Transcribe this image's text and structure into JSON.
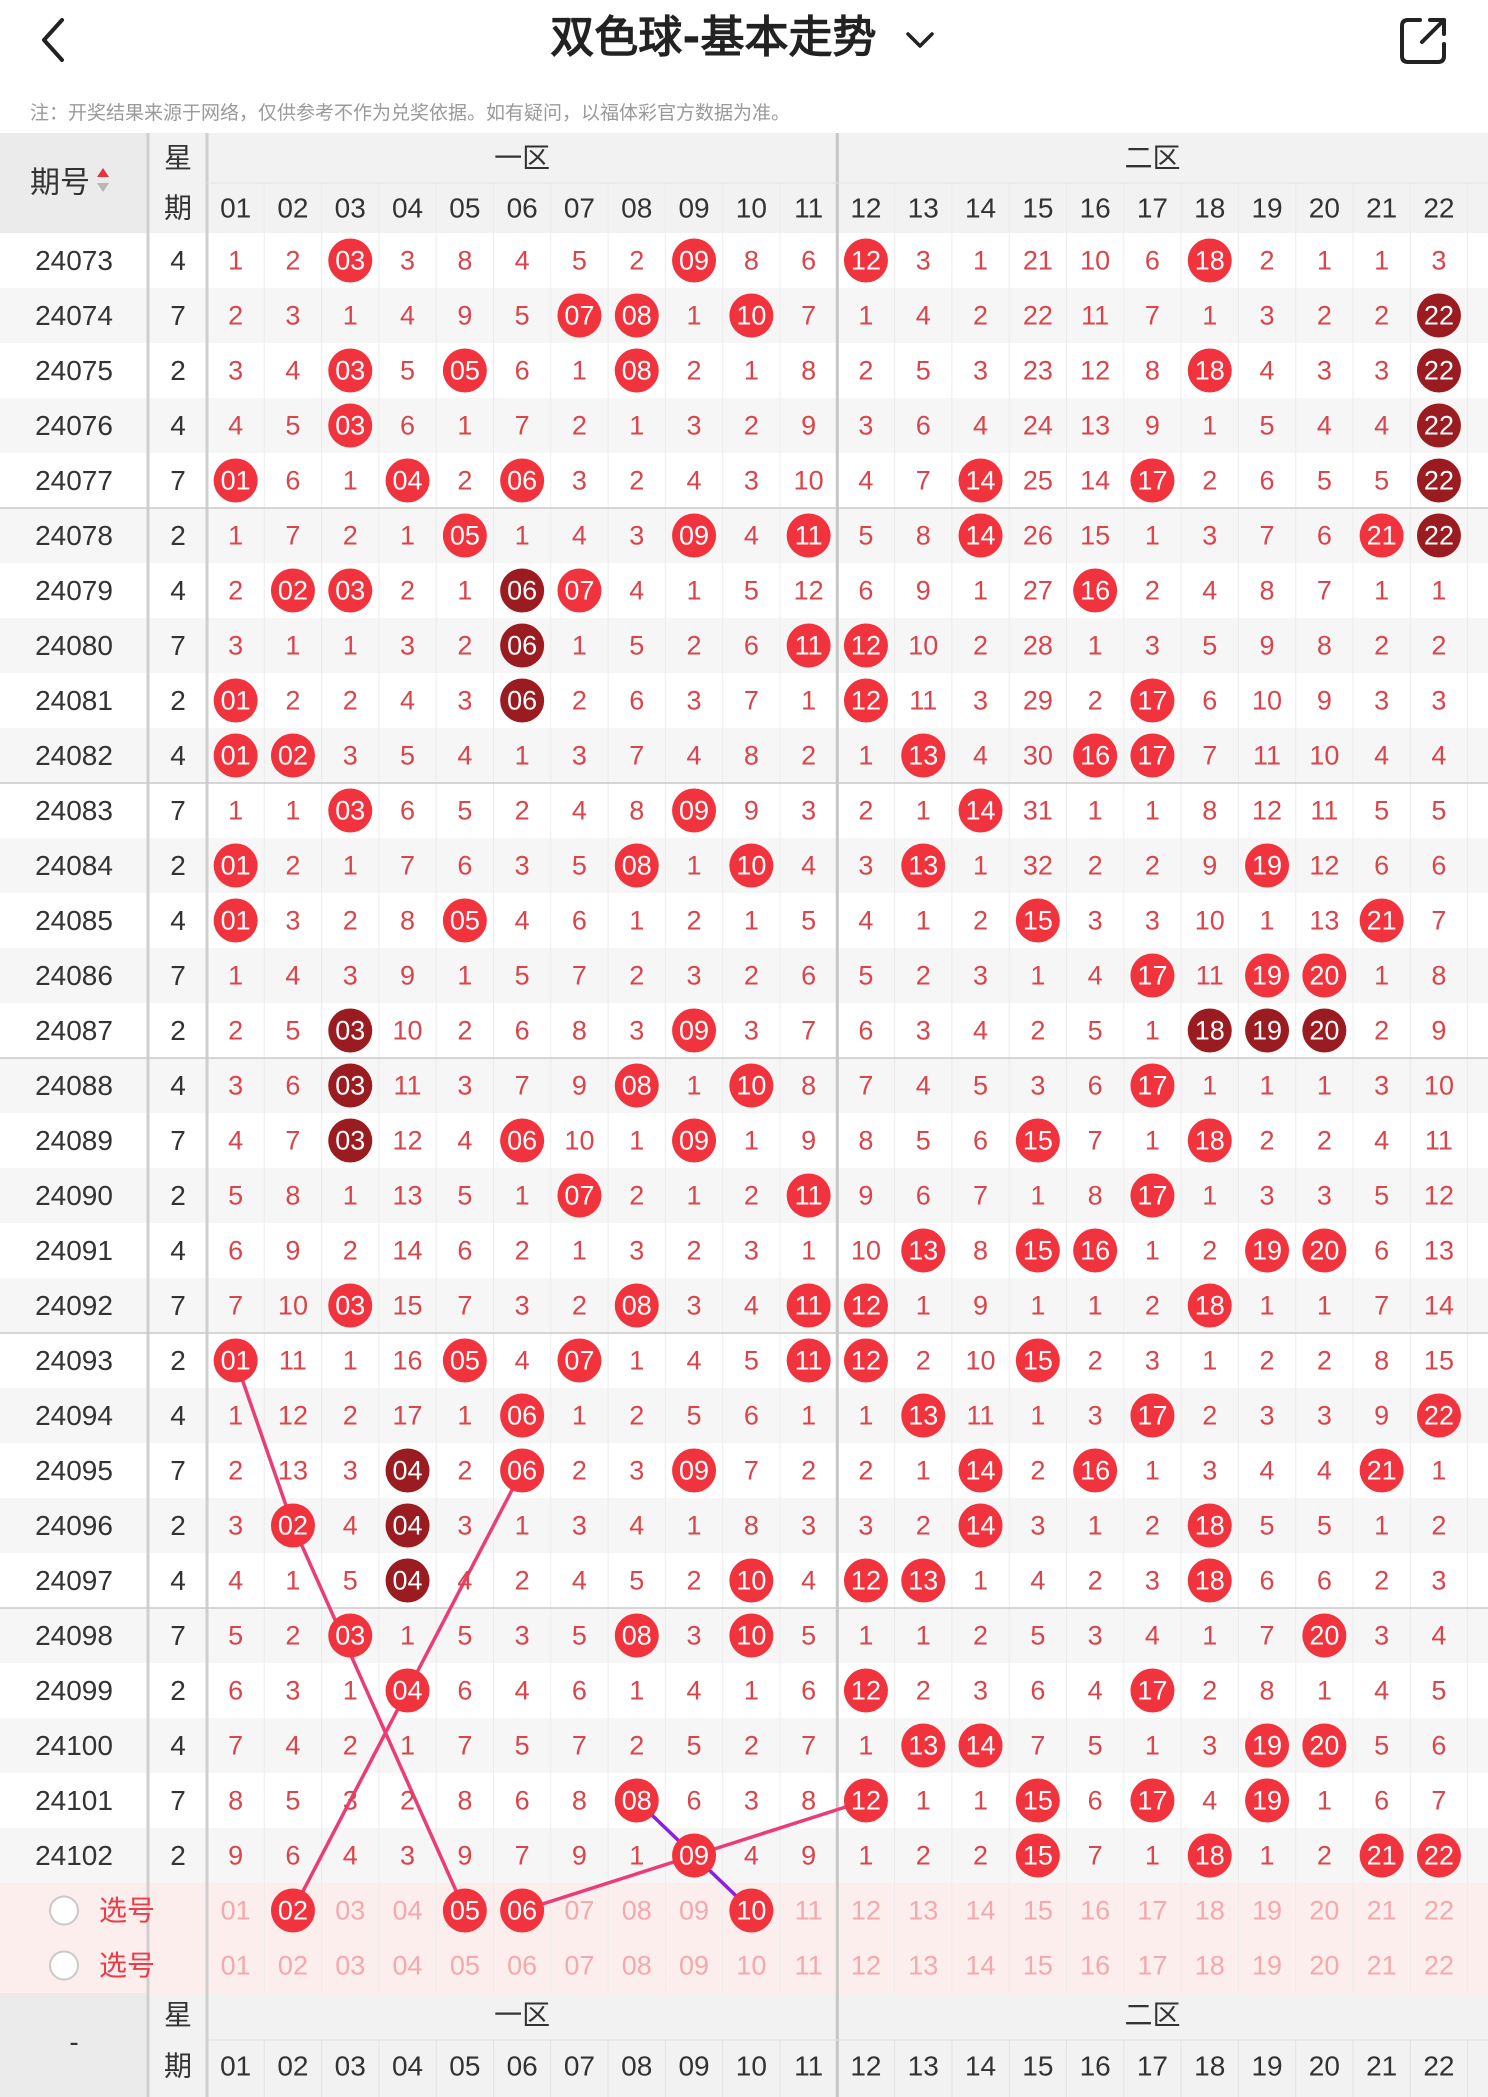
{
  "header": {
    "title": "双色球-基本走势"
  },
  "notice": "注：开奖结果来源于网络，仅供参考不作为兑奖依据。如有疑问，以福体彩官方数据为准。",
  "table": {
    "issue_header": "期号",
    "weekday_header": [
      "星",
      "期"
    ],
    "zone1_label": "一区",
    "zone2_label": "二区",
    "columns": [
      "01",
      "02",
      "03",
      "04",
      "05",
      "06",
      "07",
      "08",
      "09",
      "10",
      "11",
      "12",
      "13",
      "14",
      "15",
      "16",
      "17",
      "18",
      "19",
      "20",
      "21",
      "22"
    ],
    "rows": [
      {
        "issue": "24073",
        "weekday": "4",
        "cells": [
          "1",
          "2",
          "03",
          "3",
          "8",
          "4",
          "5",
          "2",
          "09",
          "8",
          "6",
          "12",
          "3",
          "1",
          "21",
          "10",
          "6",
          "18",
          "2",
          "1",
          "1",
          "3"
        ]
      },
      {
        "issue": "24074",
        "weekday": "7",
        "cells": [
          "2",
          "3",
          "1",
          "4",
          "9",
          "5",
          "07",
          "08",
          "1",
          "10",
          "7",
          "1",
          "4",
          "2",
          "22",
          "11",
          "7",
          "1",
          "3",
          "2",
          "2",
          "22"
        ]
      },
      {
        "issue": "24075",
        "weekday": "2",
        "cells": [
          "3",
          "4",
          "03",
          "5",
          "05",
          "6",
          "1",
          "08",
          "2",
          "1",
          "8",
          "2",
          "5",
          "3",
          "23",
          "12",
          "8",
          "18",
          "4",
          "3",
          "3",
          "22"
        ]
      },
      {
        "issue": "24076",
        "weekday": "4",
        "cells": [
          "4",
          "5",
          "03",
          "6",
          "1",
          "7",
          "2",
          "1",
          "3",
          "2",
          "9",
          "3",
          "6",
          "4",
          "24",
          "13",
          "9",
          "1",
          "5",
          "4",
          "4",
          "22"
        ]
      },
      {
        "issue": "24077",
        "weekday": "7",
        "cells": [
          "01",
          "6",
          "1",
          "04",
          "2",
          "06",
          "3",
          "2",
          "4",
          "3",
          "10",
          "4",
          "7",
          "14",
          "25",
          "14",
          "17",
          "2",
          "6",
          "5",
          "5",
          "22"
        ]
      },
      {
        "issue": "24078",
        "weekday": "2",
        "cells": [
          "1",
          "7",
          "2",
          "1",
          "05",
          "1",
          "4",
          "3",
          "09",
          "4",
          "11",
          "5",
          "8",
          "14",
          "26",
          "15",
          "1",
          "3",
          "7",
          "6",
          "21",
          "22"
        ]
      },
      {
        "issue": "24079",
        "weekday": "4",
        "cells": [
          "2",
          "02",
          "03",
          "2",
          "1",
          "06",
          "07",
          "4",
          "1",
          "5",
          "12",
          "6",
          "9",
          "1",
          "27",
          "16",
          "2",
          "4",
          "8",
          "7",
          "1",
          "1"
        ]
      },
      {
        "issue": "24080",
        "weekday": "7",
        "cells": [
          "3",
          "1",
          "1",
          "3",
          "2",
          "06",
          "1",
          "5",
          "2",
          "6",
          "11",
          "12",
          "10",
          "2",
          "28",
          "1",
          "3",
          "5",
          "9",
          "8",
          "2",
          "2"
        ]
      },
      {
        "issue": "24081",
        "weekday": "2",
        "cells": [
          "01",
          "2",
          "2",
          "4",
          "3",
          "06",
          "2",
          "6",
          "3",
          "7",
          "1",
          "12",
          "11",
          "3",
          "29",
          "2",
          "17",
          "6",
          "10",
          "9",
          "3",
          "3"
        ]
      },
      {
        "issue": "24082",
        "weekday": "4",
        "cells": [
          "01",
          "02",
          "3",
          "5",
          "4",
          "1",
          "3",
          "7",
          "4",
          "8",
          "2",
          "1",
          "13",
          "4",
          "30",
          "16",
          "17",
          "7",
          "11",
          "10",
          "4",
          "4"
        ]
      },
      {
        "issue": "24083",
        "weekday": "7",
        "cells": [
          "1",
          "1",
          "03",
          "6",
          "5",
          "2",
          "4",
          "8",
          "09",
          "9",
          "3",
          "2",
          "1",
          "14",
          "31",
          "1",
          "1",
          "8",
          "12",
          "11",
          "5",
          "5"
        ]
      },
      {
        "issue": "24084",
        "weekday": "2",
        "cells": [
          "01",
          "2",
          "1",
          "7",
          "6",
          "3",
          "5",
          "08",
          "1",
          "10",
          "4",
          "3",
          "13",
          "1",
          "32",
          "2",
          "2",
          "9",
          "19",
          "12",
          "6",
          "6"
        ]
      },
      {
        "issue": "24085",
        "weekday": "4",
        "cells": [
          "01",
          "3",
          "2",
          "8",
          "05",
          "4",
          "6",
          "1",
          "2",
          "1",
          "5",
          "4",
          "1",
          "2",
          "15",
          "3",
          "3",
          "10",
          "1",
          "13",
          "21",
          "7"
        ]
      },
      {
        "issue": "24086",
        "weekday": "7",
        "cells": [
          "1",
          "4",
          "3",
          "9",
          "1",
          "5",
          "7",
          "2",
          "3",
          "2",
          "6",
          "5",
          "2",
          "3",
          "1",
          "4",
          "17",
          "11",
          "19",
          "20",
          "1",
          "8"
        ]
      },
      {
        "issue": "24087",
        "weekday": "2",
        "cells": [
          "2",
          "5",
          "03",
          "10",
          "2",
          "6",
          "8",
          "3",
          "09",
          "3",
          "7",
          "6",
          "3",
          "4",
          "2",
          "5",
          "1",
          "18",
          "19",
          "20",
          "2",
          "9"
        ]
      },
      {
        "issue": "24088",
        "weekday": "4",
        "cells": [
          "3",
          "6",
          "03",
          "11",
          "3",
          "7",
          "9",
          "08",
          "1",
          "10",
          "8",
          "7",
          "4",
          "5",
          "3",
          "6",
          "17",
          "1",
          "1",
          "1",
          "3",
          "10"
        ]
      },
      {
        "issue": "24089",
        "weekday": "7",
        "cells": [
          "4",
          "7",
          "03",
          "12",
          "4",
          "06",
          "10",
          "1",
          "09",
          "1",
          "9",
          "8",
          "5",
          "6",
          "15",
          "7",
          "1",
          "18",
          "2",
          "2",
          "4",
          "11"
        ]
      },
      {
        "issue": "24090",
        "weekday": "2",
        "cells": [
          "5",
          "8",
          "1",
          "13",
          "5",
          "1",
          "07",
          "2",
          "1",
          "2",
          "11",
          "9",
          "6",
          "7",
          "1",
          "8",
          "17",
          "1",
          "3",
          "3",
          "5",
          "12"
        ]
      },
      {
        "issue": "24091",
        "weekday": "4",
        "cells": [
          "6",
          "9",
          "2",
          "14",
          "6",
          "2",
          "1",
          "3",
          "2",
          "3",
          "1",
          "10",
          "13",
          "8",
          "15",
          "16",
          "1",
          "2",
          "19",
          "20",
          "6",
          "13"
        ]
      },
      {
        "issue": "24092",
        "weekday": "7",
        "cells": [
          "7",
          "10",
          "03",
          "15",
          "7",
          "3",
          "2",
          "08",
          "3",
          "4",
          "11",
          "12",
          "1",
          "9",
          "1",
          "1",
          "2",
          "18",
          "1",
          "1",
          "7",
          "14"
        ]
      },
      {
        "issue": "24093",
        "weekday": "2",
        "cells": [
          "01",
          "11",
          "1",
          "16",
          "05",
          "4",
          "07",
          "1",
          "4",
          "5",
          "11",
          "12",
          "2",
          "10",
          "15",
          "2",
          "3",
          "1",
          "2",
          "2",
          "8",
          "15"
        ]
      },
      {
        "issue": "24094",
        "weekday": "4",
        "cells": [
          "1",
          "12",
          "2",
          "17",
          "1",
          "06",
          "1",
          "2",
          "5",
          "6",
          "1",
          "1",
          "13",
          "11",
          "1",
          "3",
          "17",
          "2",
          "3",
          "3",
          "9",
          "22"
        ]
      },
      {
        "issue": "24095",
        "weekday": "7",
        "cells": [
          "2",
          "13",
          "3",
          "04",
          "2",
          "06",
          "2",
          "3",
          "09",
          "7",
          "2",
          "2",
          "1",
          "14",
          "2",
          "16",
          "1",
          "3",
          "4",
          "4",
          "21",
          "1"
        ]
      },
      {
        "issue": "24096",
        "weekday": "2",
        "cells": [
          "3",
          "02",
          "4",
          "04",
          "3",
          "1",
          "3",
          "4",
          "1",
          "8",
          "3",
          "3",
          "2",
          "14",
          "3",
          "1",
          "2",
          "18",
          "5",
          "5",
          "1",
          "2"
        ]
      },
      {
        "issue": "24097",
        "weekday": "4",
        "cells": [
          "4",
          "1",
          "5",
          "04",
          "4",
          "2",
          "4",
          "5",
          "2",
          "10",
          "4",
          "12",
          "13",
          "1",
          "4",
          "2",
          "3",
          "18",
          "6",
          "6",
          "2",
          "3"
        ]
      },
      {
        "issue": "24098",
        "weekday": "7",
        "cells": [
          "5",
          "2",
          "03",
          "1",
          "5",
          "3",
          "5",
          "08",
          "3",
          "10",
          "5",
          "1",
          "1",
          "2",
          "5",
          "3",
          "4",
          "1",
          "7",
          "20",
          "3",
          "4"
        ]
      },
      {
        "issue": "24099",
        "weekday": "2",
        "cells": [
          "6",
          "3",
          "1",
          "04",
          "6",
          "4",
          "6",
          "1",
          "4",
          "1",
          "6",
          "12",
          "2",
          "3",
          "6",
          "4",
          "17",
          "2",
          "8",
          "1",
          "4",
          "5"
        ]
      },
      {
        "issue": "24100",
        "weekday": "4",
        "cells": [
          "7",
          "4",
          "2",
          "1",
          "7",
          "5",
          "7",
          "2",
          "5",
          "2",
          "7",
          "1",
          "13",
          "14",
          "7",
          "5",
          "1",
          "3",
          "19",
          "20",
          "5",
          "6"
        ]
      },
      {
        "issue": "24101",
        "weekday": "7",
        "cells": [
          "8",
          "5",
          "3",
          "2",
          "8",
          "6",
          "8",
          "08",
          "6",
          "3",
          "8",
          "12",
          "1",
          "1",
          "15",
          "6",
          "17",
          "4",
          "19",
          "1",
          "6",
          "7"
        ]
      },
      {
        "issue": "24102",
        "weekday": "2",
        "cells": [
          "9",
          "6",
          "4",
          "3",
          "9",
          "7",
          "9",
          "1",
          "09",
          "4",
          "9",
          "1",
          "2",
          "2",
          "15",
          "7",
          "1",
          "18",
          "1",
          "2",
          "21",
          "22"
        ]
      }
    ],
    "select_rows": [
      {
        "label": "选号",
        "selected": [
          "02",
          "05",
          "06",
          "10"
        ]
      },
      {
        "label": "选号",
        "selected": []
      }
    ],
    "footer_issue": "-"
  },
  "colors": {
    "ball_red": "#f0333d",
    "ball_dark": "#9a1c20",
    "number_red": "#d9454a",
    "selection_bg": "#fdeeee",
    "trend_line": "#ea3d78",
    "trend_line_alt": "#8a1fe0"
  }
}
